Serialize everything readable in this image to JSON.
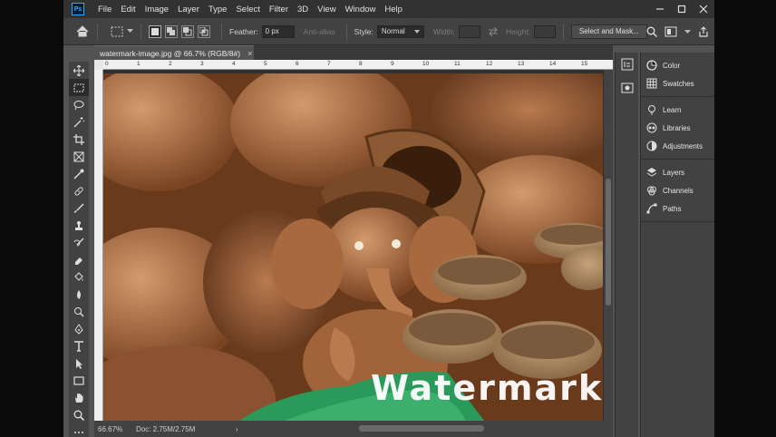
{
  "app": {
    "logo": "Ps",
    "menu": [
      "File",
      "Edit",
      "Image",
      "Layer",
      "Type",
      "Select",
      "Filter",
      "3D",
      "View",
      "Window",
      "Help"
    ]
  },
  "options_bar": {
    "feather_label": "Feather:",
    "feather_value": "0 px",
    "antialias_label": "Anti-alias",
    "style_label": "Style:",
    "style_value": "Normal",
    "width_label": "Width:",
    "height_label": "Height:",
    "select_mask_label": "Select and Mask..."
  },
  "document": {
    "tab_title": "watermark-image.jpg @ 66.7% (RGB/8#)",
    "watermark_text": "Watermark",
    "ruler_ticks": [
      "0",
      "1",
      "2",
      "3",
      "4",
      "5",
      "6",
      "7",
      "8",
      "9",
      "10",
      "11",
      "12",
      "13",
      "14",
      "15"
    ]
  },
  "status": {
    "zoom": "66.67%",
    "doc_size": "Doc: 2.75M/2.75M",
    "arrow": "›"
  },
  "panels": {
    "groups": [
      [
        {
          "label": "Color",
          "icon": "color-wheel-icon"
        },
        {
          "label": "Swatches",
          "icon": "grid-icon"
        }
      ],
      [
        {
          "label": "Learn",
          "icon": "lightbulb-icon"
        },
        {
          "label": "Libraries",
          "icon": "cloud-icon"
        },
        {
          "label": "Adjustments",
          "icon": "adjust-icon"
        }
      ],
      [
        {
          "label": "Layers",
          "icon": "layers-icon"
        },
        {
          "label": "Channels",
          "icon": "channels-icon"
        },
        {
          "label": "Paths",
          "icon": "paths-icon"
        }
      ]
    ]
  },
  "colors": {
    "menu_bg": "#323232",
    "panel_bg": "#424242",
    "workspace_bg": "#535353",
    "ps_accent": "#31a8ff"
  }
}
